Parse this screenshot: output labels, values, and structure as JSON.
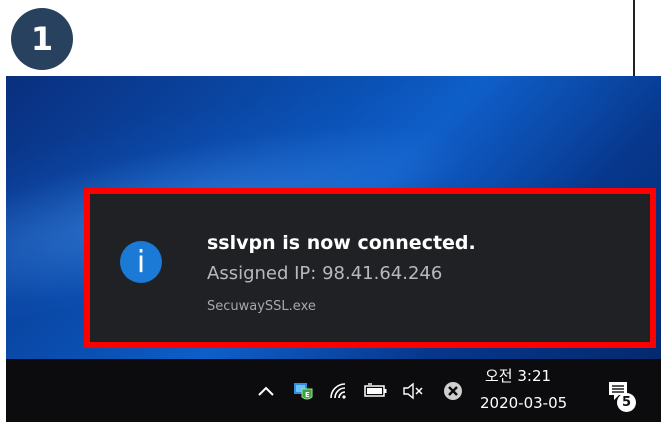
{
  "step": {
    "number": "1"
  },
  "notification": {
    "title": "sslvpn is now connected.",
    "body": "Assigned IP: 98.41.64.246",
    "app": "SecuwaySSL.exe",
    "icon": "info-icon",
    "highlight_color": "#ff0000"
  },
  "taskbar": {
    "tray_icons": [
      "chevron-up-icon",
      "vpn-shield-icon",
      "wifi-icon",
      "battery-icon",
      "speaker-muted-icon",
      "x-circle-icon"
    ],
    "clock": {
      "time": "오전 3:21",
      "date": "2020-03-05"
    },
    "action_center": {
      "icon": "action-center-icon",
      "count": "5"
    }
  },
  "colors": {
    "badge": "#27415f",
    "toast_bg": "#1f2125",
    "info_blue": "#1b7ad6",
    "taskbar_bg": "#0c0c0e"
  }
}
